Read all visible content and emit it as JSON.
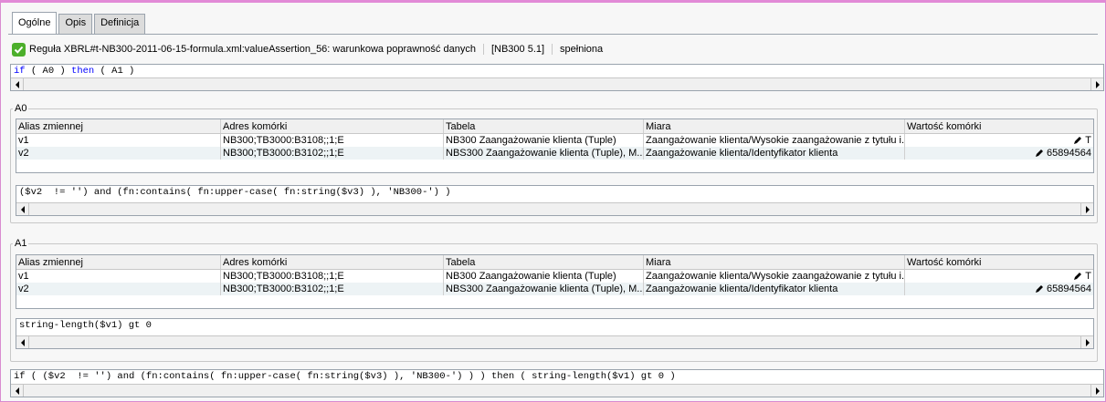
{
  "tabs": [
    {
      "label": "Ogólne",
      "active": true
    },
    {
      "label": "Opis",
      "active": false
    },
    {
      "label": "Definicja",
      "active": false
    }
  ],
  "status": {
    "rule": "Reguła XBRL#t-NB300-2011-06-15-formula.xml:valueAssertion_56: warunkowa poprawność danych",
    "version": "[NB300 5.1]",
    "result": "spełniona",
    "result_color": "#4caf2b"
  },
  "top_expression": {
    "parts": [
      "if",
      " ( A0 ) ",
      "then",
      " ( A1 )"
    ]
  },
  "groups": [
    {
      "title": "A0",
      "columns": [
        "Alias zmiennej",
        "Adres komórki",
        "Tabela",
        "Miara",
        "Wartość komórki"
      ],
      "rows": [
        [
          "v1",
          "NB300;TB3000:B3108;;1;E",
          "NB300 Zaangażowanie klienta (Tuple)",
          "Zaangażowanie klienta/Wysokie zaangażowanie z tytułu i...",
          "T"
        ],
        [
          "v2",
          "NB300;TB3000:B3102;;1;E",
          "NBS300 Zaangażowanie klienta (Tuple), M...",
          "Zaangażowanie klienta/Identyfikator klienta",
          "65894564"
        ]
      ],
      "expression": "($v2  != '') and (fn:contains( fn:upper-case( fn:string($v3) ), 'NB300-') )"
    },
    {
      "title": "A1",
      "columns": [
        "Alias zmiennej",
        "Adres komórki",
        "Tabela",
        "Miara",
        "Wartość komórki"
      ],
      "rows": [
        [
          "v1",
          "NB300;TB3000:B3108;;1;E",
          "NB300 Zaangażowanie klienta (Tuple)",
          "Zaangażowanie klienta/Wysokie zaangażowanie z tytułu i...",
          "T"
        ],
        [
          "v2",
          "NB300;TB3000:B3102;;1;E",
          "NBS300 Zaangażowanie klienta (Tuple), M...",
          "Zaangażowanie klienta/Identyfikator klienta",
          "65894564"
        ]
      ],
      "expression": "string-length($v1) gt 0"
    }
  ],
  "bottom_expression": {
    "text": "if ( ($v2  != '') and (fn:contains( fn:upper-case( fn:string($v3) ), 'NB300-') ) ) then ( string-length($v1) gt 0 )"
  },
  "icons": {
    "check": "check-icon",
    "pencil": "pencil-icon",
    "scroll_left": "arrow-left-icon",
    "scroll_right": "arrow-right-icon"
  }
}
